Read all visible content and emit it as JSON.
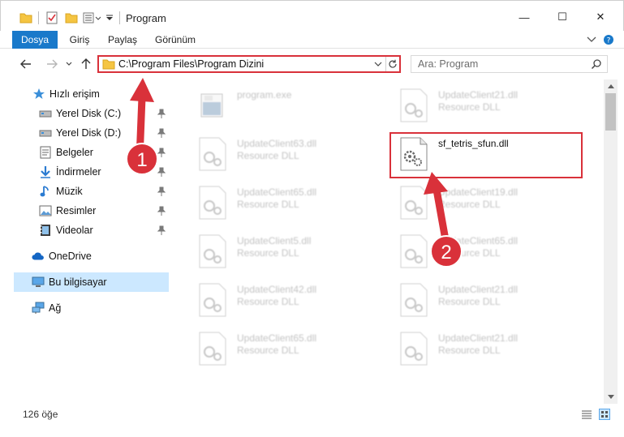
{
  "window": {
    "title": "Program",
    "minimize_symbol": "—",
    "maximize_symbol": "☐",
    "close_symbol": "✕"
  },
  "ribbon": {
    "tabs": [
      {
        "label": "Dosya"
      },
      {
        "label": "Giriş"
      },
      {
        "label": "Paylaş"
      },
      {
        "label": "Görünüm"
      }
    ]
  },
  "address": {
    "path": "C:\\Program Files\\Program Dizini"
  },
  "search": {
    "placeholder": "Ara: Program"
  },
  "sidebar": {
    "items": [
      {
        "label": "Hızlı erişim",
        "icon": "star-icon",
        "pinned": false
      },
      {
        "label": "Yerel Disk (C:)",
        "icon": "drive-icon",
        "pinned": true
      },
      {
        "label": "Yerel Disk (D:)",
        "icon": "drive-icon",
        "pinned": true
      },
      {
        "label": "Belgeler",
        "icon": "documents-icon",
        "pinned": true
      },
      {
        "label": "İndirmeler",
        "icon": "download-icon",
        "pinned": true
      },
      {
        "label": "Müzik",
        "icon": "music-icon",
        "pinned": true
      },
      {
        "label": "Resimler",
        "icon": "pictures-icon",
        "pinned": true
      },
      {
        "label": "Videolar",
        "icon": "videos-icon",
        "pinned": true
      },
      {
        "label": "OneDrive",
        "icon": "cloud-icon",
        "pinned": false
      },
      {
        "label": "Bu bilgisayar",
        "icon": "computer-icon",
        "pinned": false
      },
      {
        "label": "Ağ",
        "icon": "network-icon",
        "pinned": false
      }
    ]
  },
  "files": [
    {
      "name": "program.exe",
      "type": "",
      "faded": true
    },
    {
      "name": "UpdateClient21.dll",
      "type": "Resource DLL",
      "faded": true
    },
    {
      "name": "UpdateClient63.dll",
      "type": "Resource DLL",
      "faded": true
    },
    {
      "name": "sf_tetris_sfun.dll",
      "type": "",
      "faded": false
    },
    {
      "name": "UpdateClient65.dll",
      "type": "Resource DLL",
      "faded": true
    },
    {
      "name": "UpdateClient19.dll",
      "type": "Resource DLL",
      "faded": true
    },
    {
      "name": "UpdateClient5.dll",
      "type": "Resource DLL",
      "faded": true
    },
    {
      "name": "UpdateClient65.dll",
      "type": "Resource DLL",
      "faded": true
    },
    {
      "name": "UpdateClient42.dll",
      "type": "Resource DLL",
      "faded": true
    },
    {
      "name": "UpdateClient21.dll",
      "type": "Resource DLL",
      "faded": true
    },
    {
      "name": "UpdateClient65.dll",
      "type": "Resource DLL",
      "faded": true
    },
    {
      "name": "UpdateClient21.dll",
      "type": "Resource DLL",
      "faded": true
    }
  ],
  "status": {
    "item_count": "126 öğe"
  },
  "annotations": {
    "step1": "1",
    "step2": "2",
    "color": "#d9313a"
  }
}
